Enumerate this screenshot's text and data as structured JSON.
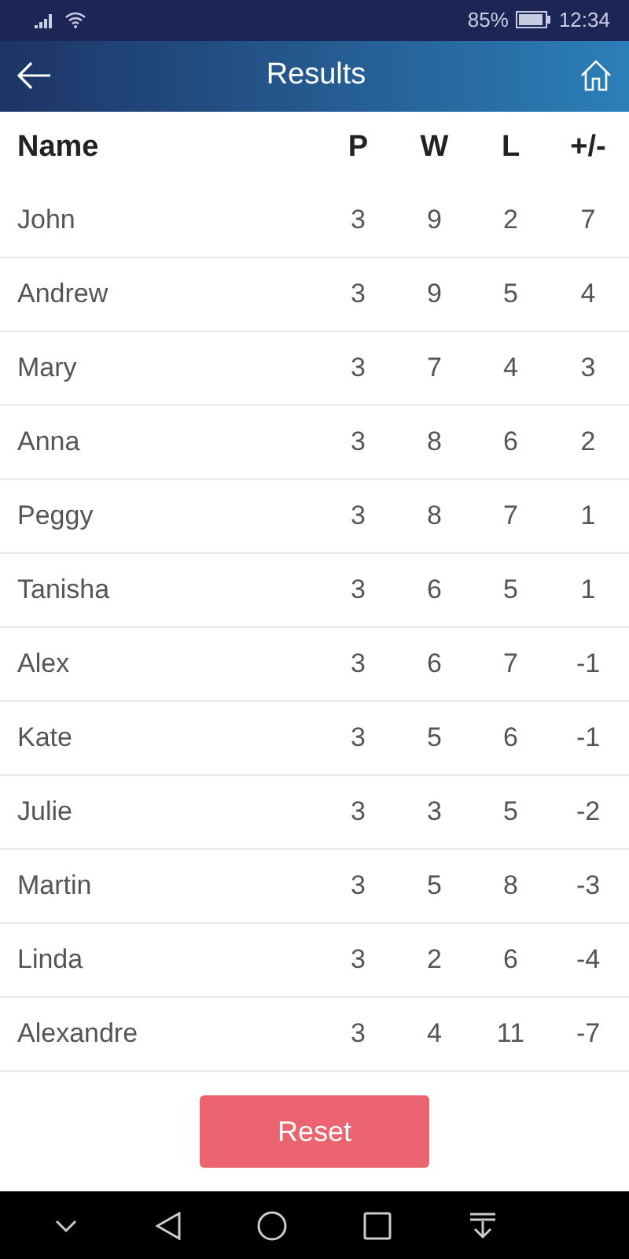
{
  "status_bar": {
    "battery": "85%",
    "time": "12:34"
  },
  "header": {
    "title": "Results"
  },
  "table": {
    "columns": [
      "Name",
      "P",
      "W",
      "L",
      "+/-"
    ],
    "rows": [
      [
        "John",
        "3",
        "9",
        "2",
        "7"
      ],
      [
        "Andrew",
        "3",
        "9",
        "5",
        "4"
      ],
      [
        "Mary",
        "3",
        "7",
        "4",
        "3"
      ],
      [
        "Anna",
        "3",
        "8",
        "6",
        "2"
      ],
      [
        "Peggy",
        "3",
        "8",
        "7",
        "1"
      ],
      [
        "Tanisha",
        "3",
        "6",
        "5",
        "1"
      ],
      [
        "Alex",
        "3",
        "6",
        "7",
        "-1"
      ],
      [
        "Kate",
        "3",
        "5",
        "6",
        "-1"
      ],
      [
        "Julie",
        "3",
        "3",
        "5",
        "-2"
      ],
      [
        "Martin",
        "3",
        "5",
        "8",
        "-3"
      ],
      [
        "Linda",
        "3",
        "2",
        "6",
        "-4"
      ],
      [
        "Alexandre",
        "3",
        "4",
        "11",
        "-7"
      ]
    ]
  },
  "reset_button": "Reset"
}
